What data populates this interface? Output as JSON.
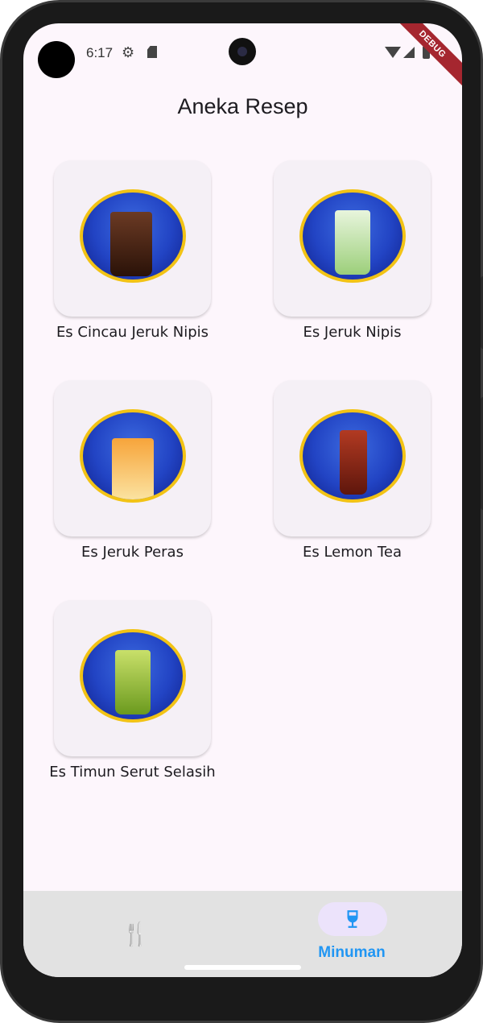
{
  "status_bar": {
    "time": "6:17",
    "debug_label": "DEBUG",
    "icons": [
      "gear-icon",
      "sd-card-icon",
      "wifi-icon",
      "signal-icon",
      "battery-icon"
    ]
  },
  "app_bar": {
    "title": "Aneka Resep"
  },
  "recipes": [
    {
      "name": "Es Cincau Jeruk Nipis",
      "color": "#3a1c0e"
    },
    {
      "name": "Es Jeruk Nipis",
      "color": "#b9e0a0"
    },
    {
      "name": "Es Jeruk Peras",
      "color": "#f4b940"
    },
    {
      "name": "Es Lemon Tea",
      "color": "#8b2a1a"
    },
    {
      "name": "Es Timun Serut Selasih",
      "color": "#9ec43a"
    }
  ],
  "bottom_nav": {
    "items": [
      {
        "label": "",
        "icon": "utensils-icon",
        "selected": false
      },
      {
        "label": "Minuman",
        "icon": "wine-glass-icon",
        "selected": true
      }
    ]
  },
  "colors": {
    "background": "#fdf6fc",
    "card": "#f5f0f6",
    "image_frame": "#f2c315",
    "image_bg": "#2244c4",
    "nav_active": "#2196f3",
    "nav_pill": "#ece3fb",
    "debug_banner": "#a5262f"
  }
}
